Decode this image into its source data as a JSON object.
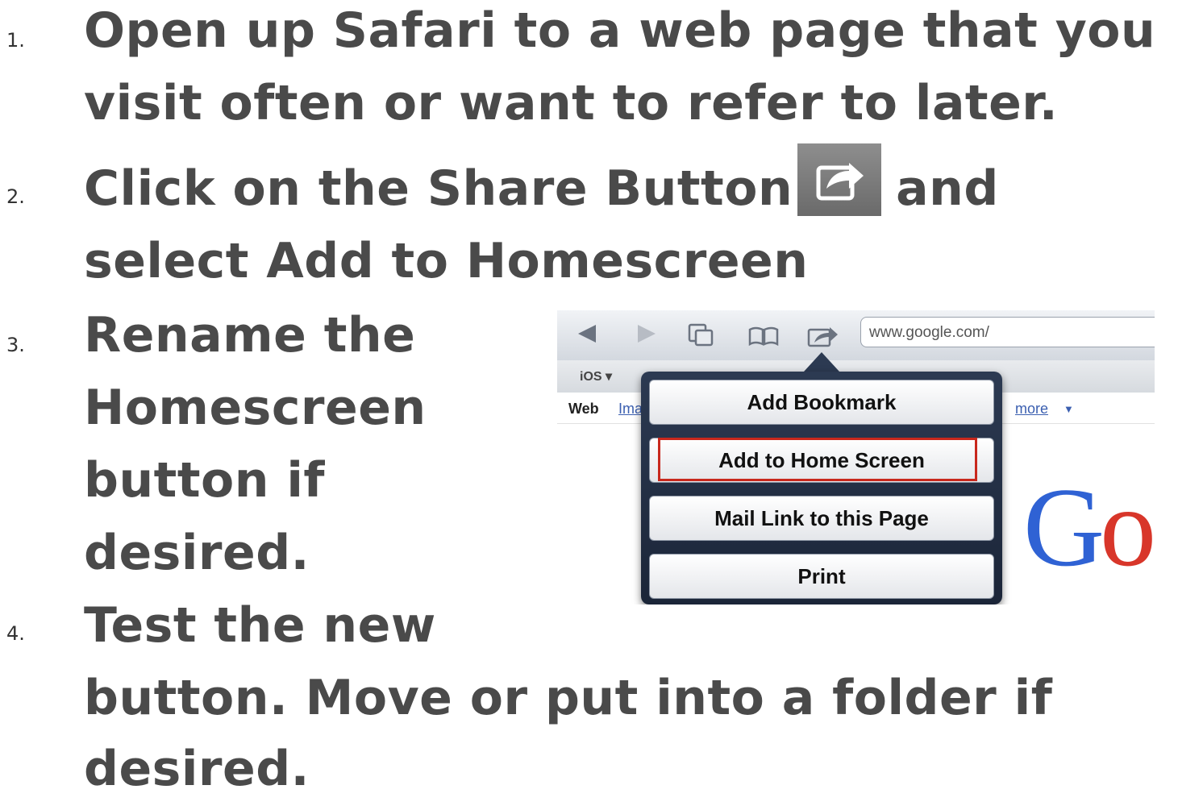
{
  "steps": [
    {
      "number": "1.",
      "lines": [
        "Open up Safari to a web page that you",
        "visit often or want to refer to later."
      ]
    },
    {
      "number": "2.",
      "line1_pre": "Click on the Share Button",
      "line1_post": "and",
      "line2": "select Add to Homescreen"
    },
    {
      "number": "3.",
      "lines": [
        "Rename the",
        "Homescreen",
        "button if",
        "desired."
      ]
    },
    {
      "number": "4.",
      "lines": [
        "Test the new",
        "button.  Move or put into a folder if",
        "desired."
      ]
    }
  ],
  "share_icon": "share-arrow-icon",
  "safari": {
    "url": "www.google.com/",
    "ios_label": "iOS ▾",
    "tabs": {
      "web": "Web",
      "images": "Ima",
      "more": "more",
      "more_arrow": "▼"
    },
    "menu_items": [
      "Add Bookmark",
      "Add to Home Screen",
      "Mail Link to this Page",
      "Print"
    ],
    "highlight_color": "#c8281d",
    "logo_visible": "Go"
  }
}
